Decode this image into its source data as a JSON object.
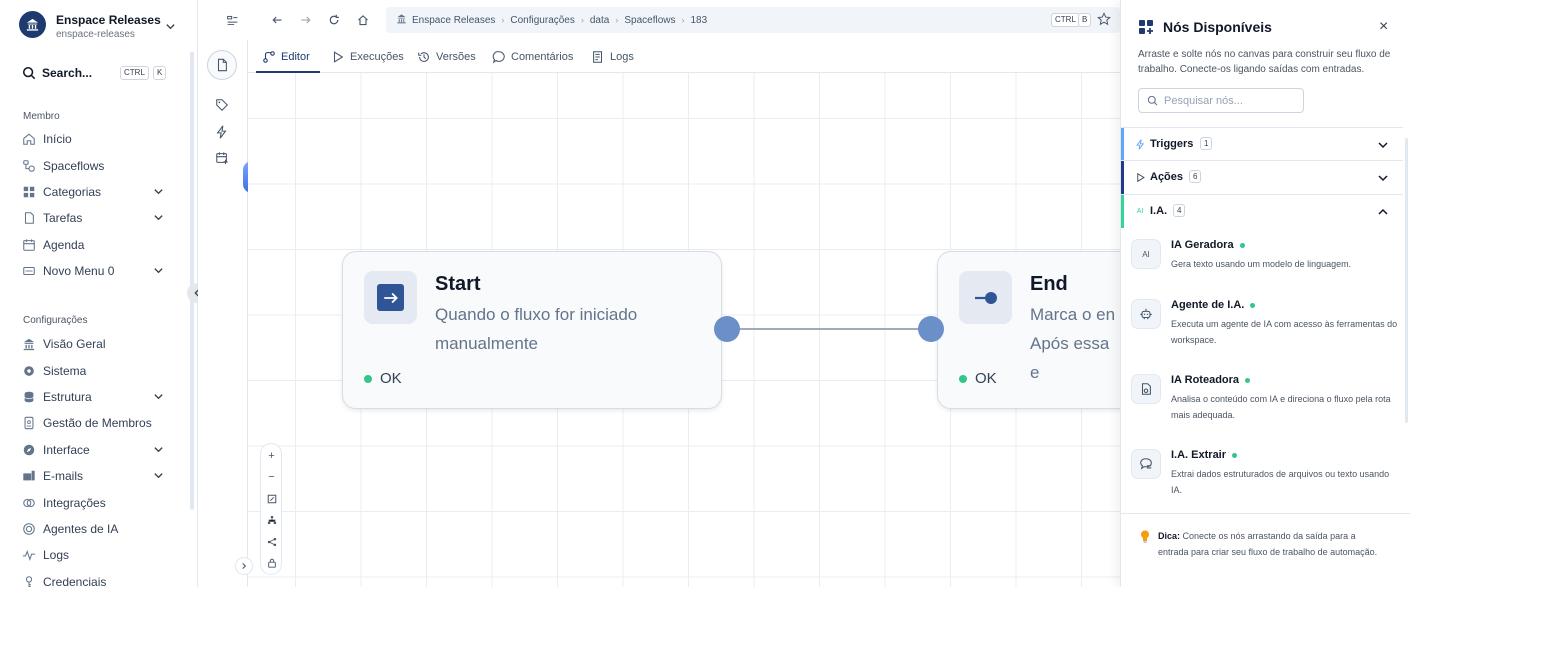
{
  "workspace": {
    "name": "Enspace Releases",
    "slug": "enspace-releases"
  },
  "search": {
    "label": "Search...",
    "kbd1": "CTRL",
    "kbd2": "K"
  },
  "sidebar": {
    "member_title": "Membro",
    "member_items": [
      {
        "label": "Início",
        "icon": "home-icon"
      },
      {
        "label": "Spaceflows",
        "icon": "spaceflows-icon"
      },
      {
        "label": "Categorias",
        "icon": "categories-icon",
        "expandable": true
      },
      {
        "label": "Tarefas",
        "icon": "tasks-icon",
        "expandable": true
      },
      {
        "label": "Agenda",
        "icon": "calendar-icon"
      },
      {
        "label": "Novo Menu 0",
        "icon": "menu-icon",
        "expandable": true
      }
    ],
    "config_title": "Configurações",
    "config_items": [
      {
        "label": "Visão Geral",
        "icon": "building-icon"
      },
      {
        "label": "Sistema",
        "icon": "gear-icon"
      },
      {
        "label": "Estrutura",
        "icon": "database-icon",
        "expandable": true
      },
      {
        "label": "Gestão de Membros",
        "icon": "id-card-icon"
      },
      {
        "label": "Interface",
        "icon": "compass-icon",
        "expandable": true
      },
      {
        "label": "E-mails",
        "icon": "mail-icon",
        "expandable": true
      },
      {
        "label": "Integrações",
        "icon": "integrations-icon"
      },
      {
        "label": "Agentes de IA",
        "icon": "ai-agent-icon"
      },
      {
        "label": "Logs",
        "icon": "logs-icon"
      },
      {
        "label": "Credenciais",
        "icon": "key-icon"
      }
    ]
  },
  "breadcrumb": {
    "items": [
      "Enspace Releases",
      "Configurações",
      "data",
      "Spaceflows",
      "183"
    ],
    "kbd1": "CTRL",
    "kbd2": "B"
  },
  "tabs": [
    {
      "label": "Editor",
      "icon": "editor-icon",
      "active": true
    },
    {
      "label": "Execuções",
      "icon": "play-icon"
    },
    {
      "label": "Versões",
      "icon": "history-icon"
    },
    {
      "label": "Comentários",
      "icon": "comment-icon"
    },
    {
      "label": "Logs",
      "icon": "logs-icon"
    }
  ],
  "nodes": {
    "start": {
      "title": "Start",
      "description": "Quando o fluxo for iniciado manualmente",
      "status": "OK"
    },
    "end": {
      "title": "End",
      "description": "Marca o en Após essa e",
      "status": "OK"
    }
  },
  "zoom_controls": [
    "+",
    "−"
  ],
  "panel": {
    "title": "Nós Disponíveis",
    "close": "×",
    "description": "Arraste e solte nós no canvas para construir seu fluxo de trabalho. Conecte-os ligando saídas com entradas.",
    "search_placeholder": "Pesquisar nós...",
    "categories": [
      {
        "label": "Triggers",
        "count": "1",
        "color": "#60a5fa",
        "expanded": false
      },
      {
        "label": "Ações",
        "count": "6",
        "color": "#1e3a8a",
        "expanded": false
      },
      {
        "label": "I.A.",
        "count": "4",
        "color": "#34d399",
        "expanded": true
      }
    ],
    "ai_icon_text": "AI",
    "ai_items": [
      {
        "name": "IA Geradora",
        "description": "Gera texto usando um modelo de linguagem.",
        "icon": "ai-generator-icon",
        "icon_text": "AI"
      },
      {
        "name": "Agente de I.A.",
        "description": "Executa um agente de IA com acesso às ferramentas do workspace.",
        "icon": "robot-icon"
      },
      {
        "name": "IA Roteadora",
        "description": "Analisa o conteúdo com IA e direciona o fluxo pela rota mais adequada.",
        "icon": "router-icon"
      },
      {
        "name": "I.A. Extrair",
        "description": "Extrai dados estruturados de arquivos ou texto usando IA.",
        "icon": "extract-icon"
      }
    ],
    "tip_label": "Dica:",
    "tip_text": " Conecte os nós arrastando da saída para a entrada para criar seu fluxo de trabalho de automação."
  },
  "colors": {
    "brand": "#1e3a6e",
    "node_handle": "#6b8fc8",
    "status_ok": "#34c58a"
  }
}
